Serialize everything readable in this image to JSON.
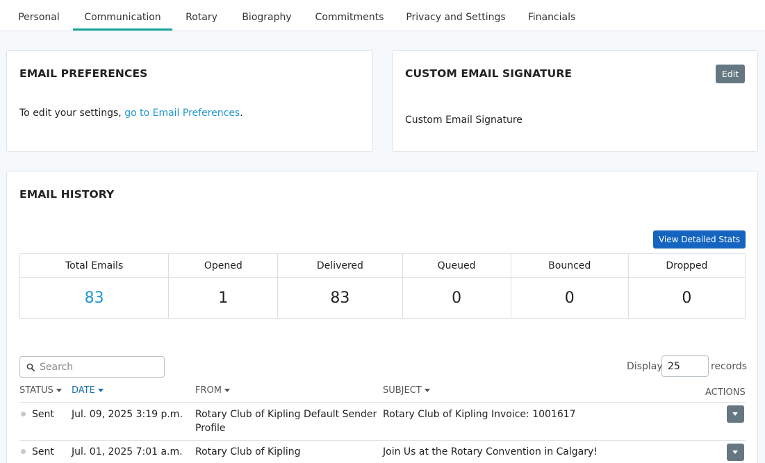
{
  "tabs": [
    {
      "label": "Personal"
    },
    {
      "label": "Communication"
    },
    {
      "label": "Rotary"
    },
    {
      "label": "Biography"
    },
    {
      "label": "Commitments"
    },
    {
      "label": "Privacy and Settings"
    },
    {
      "label": "Financials"
    }
  ],
  "active_tab": "Communication",
  "email_prefs": {
    "title": "EMAIL PREFERENCES",
    "text_before": "To edit your settings, ",
    "link": "go to Email Preferences",
    "text_after": "."
  },
  "signature": {
    "title": "CUSTOM EMAIL SIGNATURE",
    "edit_label": "Edit",
    "body": "Custom Email Signature"
  },
  "history": {
    "title": "EMAIL HISTORY",
    "stats_button": "View Detailed Stats",
    "stats": [
      {
        "label": "Total Emails",
        "value": "83"
      },
      {
        "label": "Opened",
        "value": "1"
      },
      {
        "label": "Delivered",
        "value": "83"
      },
      {
        "label": "Queued",
        "value": "0"
      },
      {
        "label": "Bounced",
        "value": "0"
      },
      {
        "label": "Dropped",
        "value": "0"
      }
    ],
    "search_placeholder": "Search",
    "display_label": "Display",
    "display_value": "25",
    "records_label": "records",
    "columns": {
      "status": "STATUS",
      "date": "DATE",
      "from": "FROM",
      "subject": "SUBJECT",
      "actions": "ACTIONS"
    },
    "rows": [
      {
        "status": "Sent",
        "date": "Jul. 09, 2025 3:19 p.m.",
        "from": "Rotary Club of Kipling Default Sender Profile",
        "subject": "Rotary Club of Kipling Invoice: 1001617"
      },
      {
        "status": "Sent",
        "date": "Jul. 01, 2025 7:01 a.m.",
        "from": "Rotary Club of Kipling",
        "subject": "Join Us at the Rotary Convention in Calgary!"
      }
    ]
  },
  "colors": {
    "accent_teal": "#17a59a",
    "link_blue": "#1e96d2",
    "primary_button": "#1565c0",
    "secondary_button": "#657881"
  }
}
